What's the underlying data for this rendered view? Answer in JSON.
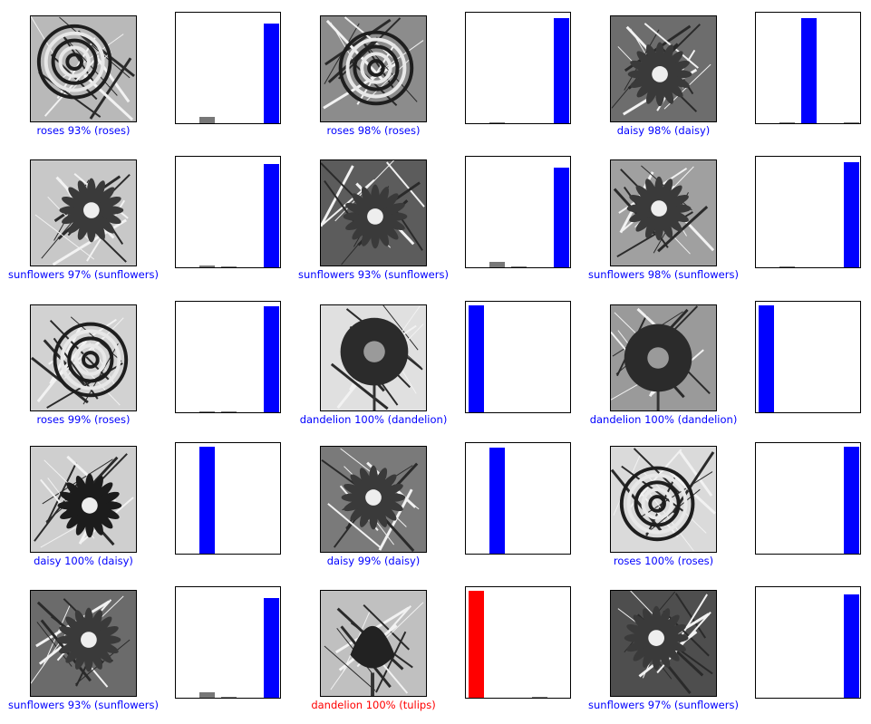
{
  "colors": {
    "correct": "#0000ff",
    "wrong": "#ff0000",
    "other": "#777777",
    "background": "#ffffff"
  },
  "chart_data": [
    {
      "type": "bar",
      "categories": [
        "daisy",
        "dandelion",
        "roses",
        "sunflowers",
        "tulips"
      ],
      "values": [
        0,
        0.06,
        0,
        0,
        0.93
      ],
      "label": "roses 93% (roses)",
      "correct": true,
      "image": "rose-photo"
    },
    {
      "type": "bar",
      "categories": [
        "daisy",
        "dandelion",
        "roses",
        "sunflowers",
        "tulips"
      ],
      "values": [
        0,
        0.01,
        0,
        0,
        0.98
      ],
      "label": "roses 98% (roses)",
      "correct": true,
      "image": "rose-arch-photo"
    },
    {
      "type": "bar",
      "categories": [
        "daisy",
        "dandelion",
        "roses",
        "sunflowers",
        "tulips"
      ],
      "values": [
        0,
        0.01,
        0.98,
        0,
        0.01
      ],
      "label": "daisy 98% (daisy)",
      "correct": true,
      "image": "daisy-photo"
    },
    {
      "type": "bar",
      "categories": [
        "daisy",
        "dandelion",
        "roses",
        "sunflowers",
        "tulips"
      ],
      "values": [
        0,
        0.02,
        0.01,
        0,
        0.97
      ],
      "label": "sunflowers 97% (sunflowers)",
      "correct": true,
      "image": "sunflower-sketch-photo"
    },
    {
      "type": "bar",
      "categories": [
        "daisy",
        "dandelion",
        "roses",
        "sunflowers",
        "tulips"
      ],
      "values": [
        0,
        0.05,
        0.01,
        0,
        0.93
      ],
      "label": "sunflowers 93% (sunflowers)",
      "correct": true,
      "image": "flower-stem-photo"
    },
    {
      "type": "bar",
      "categories": [
        "daisy",
        "dandelion",
        "roses",
        "sunflowers",
        "tulips"
      ],
      "values": [
        0,
        0.01,
        0,
        0,
        0.98
      ],
      "label": "sunflowers 98% (sunflowers)",
      "correct": true,
      "image": "sunflower-field-photo"
    },
    {
      "type": "bar",
      "categories": [
        "daisy",
        "dandelion",
        "roses",
        "sunflowers",
        "tulips"
      ],
      "values": [
        0,
        0.01,
        0.01,
        0,
        0.99
      ],
      "label": "roses 99% (roses)",
      "correct": true,
      "image": "dark-rose-photo"
    },
    {
      "type": "bar",
      "categories": [
        "daisy",
        "dandelion",
        "roses",
        "sunflowers",
        "tulips"
      ],
      "values": [
        1.0,
        0,
        0,
        0,
        0
      ],
      "label": "dandelion 100% (dandelion)",
      "correct": true,
      "image": "dandelion-photo"
    },
    {
      "type": "bar",
      "categories": [
        "daisy",
        "dandelion",
        "roses",
        "sunflowers",
        "tulips"
      ],
      "values": [
        1.0,
        0,
        0,
        0,
        0
      ],
      "label": "dandelion 100% (dandelion)",
      "correct": true,
      "image": "dandelion-dark-photo"
    },
    {
      "type": "bar",
      "categories": [
        "daisy",
        "dandelion",
        "roses",
        "sunflowers",
        "tulips"
      ],
      "values": [
        0,
        1.0,
        0,
        0,
        0
      ],
      "label": "daisy 100% (daisy)",
      "correct": true,
      "image": "dark-daisy-photo"
    },
    {
      "type": "bar",
      "categories": [
        "daisy",
        "dandelion",
        "roses",
        "sunflowers",
        "tulips"
      ],
      "values": [
        0,
        0.99,
        0,
        0,
        0
      ],
      "label": "daisy 99% (daisy)",
      "correct": true,
      "image": "daisy-group-photo"
    },
    {
      "type": "bar",
      "categories": [
        "daisy",
        "dandelion",
        "roses",
        "sunflowers",
        "tulips"
      ],
      "values": [
        0,
        0,
        0,
        0,
        1.0
      ],
      "label": "roses 100% (roses)",
      "correct": true,
      "image": "rose-bouquet-photo"
    },
    {
      "type": "bar",
      "categories": [
        "daisy",
        "dandelion",
        "roses",
        "sunflowers",
        "tulips"
      ],
      "values": [
        0,
        0.05,
        0.01,
        0,
        0.93
      ],
      "label": "sunflowers 93% (sunflowers)",
      "correct": true,
      "image": "sunflower-stalk-photo"
    },
    {
      "type": "bar",
      "categories": [
        "daisy",
        "dandelion",
        "roses",
        "sunflowers",
        "tulips"
      ],
      "values": [
        1.0,
        0,
        0,
        0.01,
        0
      ],
      "label": "dandelion 100% (tulips)",
      "correct": false,
      "image": "tulip-photo"
    },
    {
      "type": "bar",
      "categories": [
        "daisy",
        "dandelion",
        "roses",
        "sunflowers",
        "tulips"
      ],
      "values": [
        0,
        0,
        0,
        0,
        0.97
      ],
      "label": "sunflowers 97% (sunflowers)",
      "correct": true,
      "image": "blurry-sunflower-photo"
    }
  ]
}
